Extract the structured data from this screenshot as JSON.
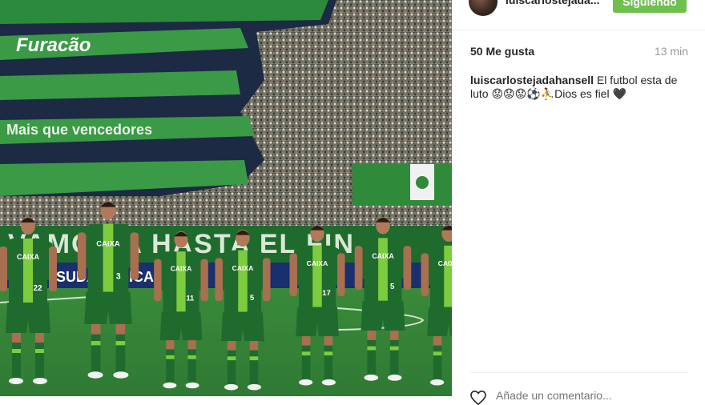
{
  "post": {
    "username": "luiscarlostejada...",
    "follow_label": "Siguiendo",
    "likes": "50 Me gusta",
    "time": "13 min",
    "caption_user": "luiscarlostejadahansell",
    "caption_text": " El futbol esta de luto 😟😟😟⚽⛹Dios es fiel 🖤",
    "comment_placeholder": "Añade un comentario..."
  },
  "photo": {
    "banner_text_1": "Furacão",
    "banner_text_2": "Mais que vencedores",
    "ad_text_1": "VAMOS A HASTA EL FIN",
    "ad_text_2": "SUDAMERICANA",
    "shirt_text": "CAIXA",
    "players": [
      {
        "number": "22"
      },
      {
        "number": "3"
      },
      {
        "number": "11"
      },
      {
        "number": "5"
      },
      {
        "number": "17"
      },
      {
        "number": "5"
      },
      {
        "number": ""
      }
    ]
  },
  "colors": {
    "follow_green": "#70c050",
    "kit_green": "#1f6b2d",
    "kit_light": "#7dcc3f",
    "pitch": "#2f7a34"
  }
}
